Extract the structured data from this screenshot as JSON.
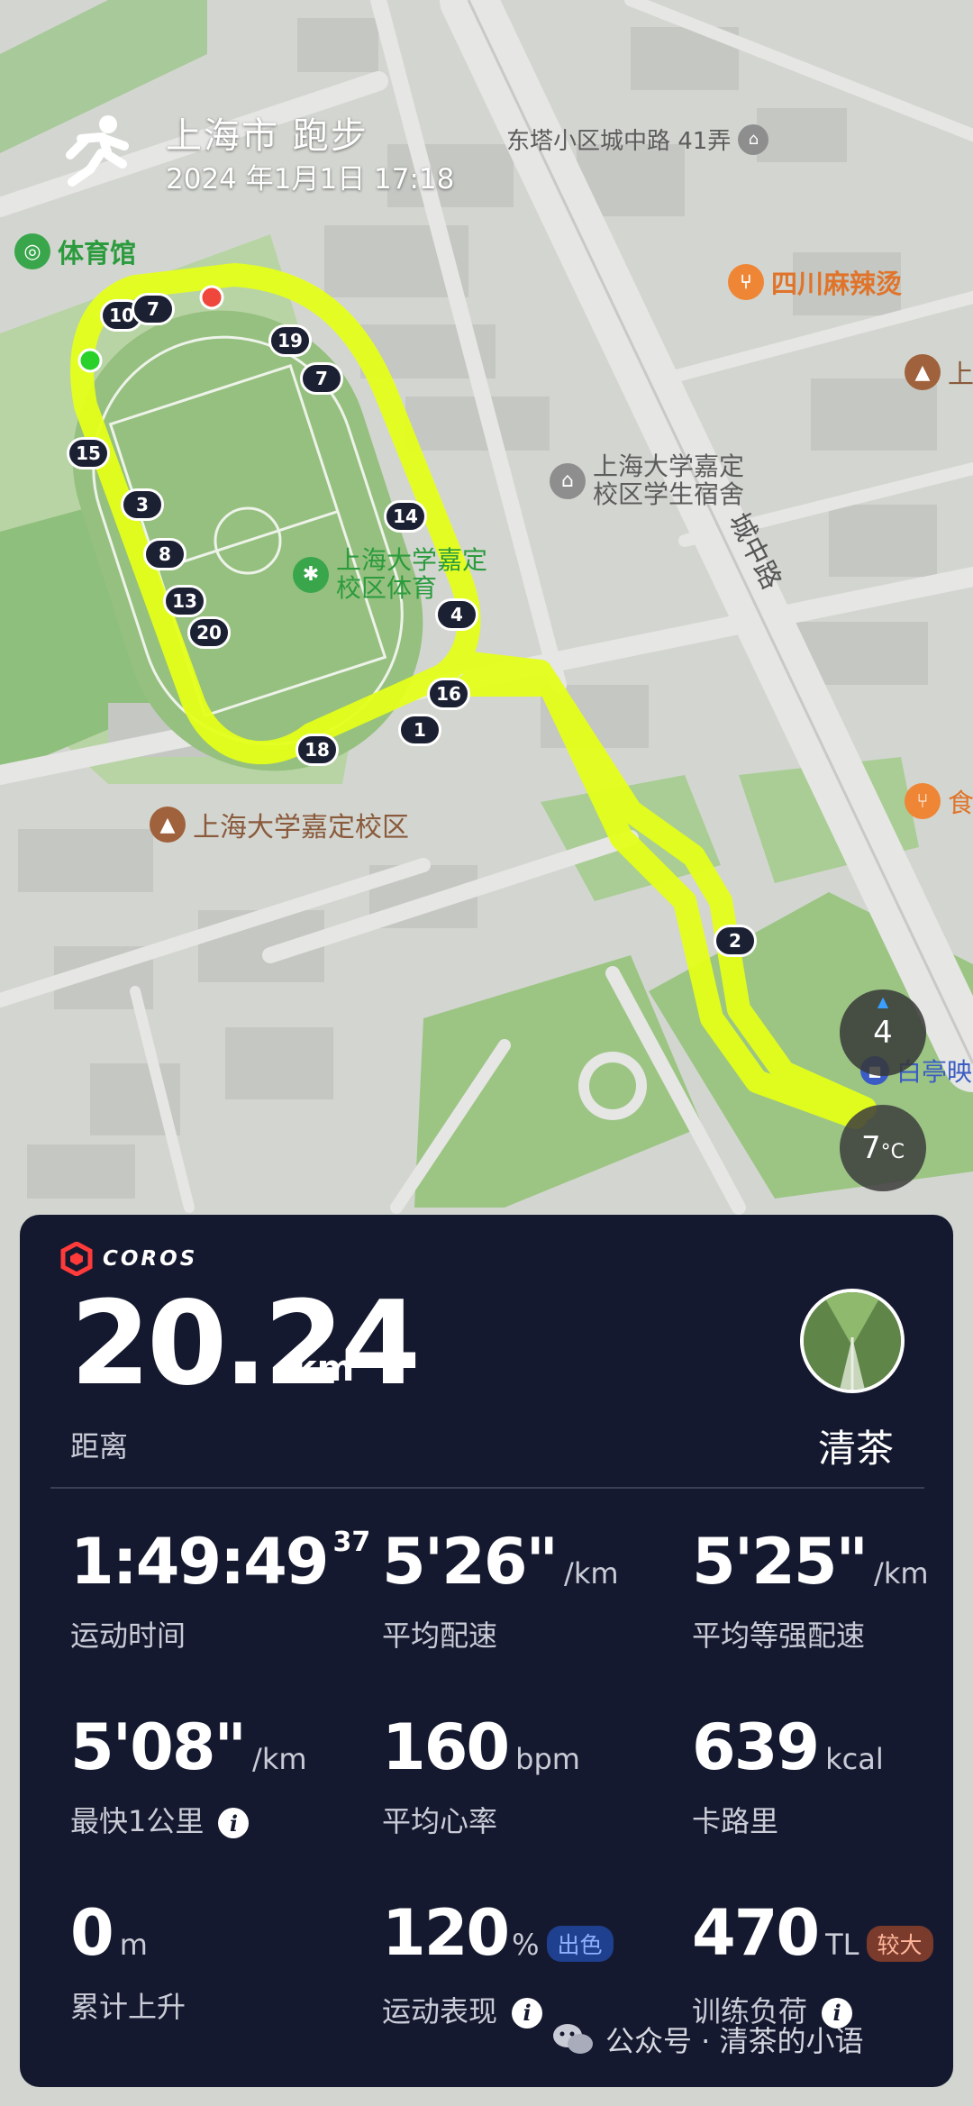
{
  "header": {
    "title": "上海市 跑步",
    "datetime": "2024 年1月1日 17:18"
  },
  "map": {
    "pois": {
      "stadium": "体育馆",
      "dongta_road": "东塔小区城中路 41弄",
      "sichuan": "四川麻辣烫",
      "shu_gym_line1": "上海大学嘉定",
      "shu_gym_line2": "校区体育",
      "dorm_line1": "上海大学嘉定",
      "dorm_line2": "校区学生宿舍",
      "chengzhong_road": "城中路",
      "campus": "上海大学嘉定校区",
      "baiting": "白亭映",
      "edge_shang": "上",
      "edge_shi": "食"
    },
    "km_markers": [
      "10",
      "7",
      "19",
      "7",
      "15",
      "3",
      "8",
      "13",
      "20",
      "14",
      "4",
      "16",
      "1",
      "18",
      "2"
    ],
    "compass_value": "4",
    "temperature": "7",
    "temperature_unit": "°C",
    "route_color": "#e4ff1a"
  },
  "card": {
    "brand": "COROS",
    "distance": "20.24",
    "distance_unit": "km",
    "distance_label": "距离",
    "username": "清茶",
    "stats": {
      "time_main": "1:49:49",
      "time_sup": "37",
      "time_label": "运动时间",
      "avg_pace": "5'26\"",
      "avg_pace_unit": "/km",
      "avg_pace_label": "平均配速",
      "grade_pace": "5'25\"",
      "grade_pace_unit": "/km",
      "grade_pace_label": "平均等强配速",
      "fastest_km": "5'08\"",
      "fastest_km_unit": "/km",
      "fastest_km_label": "最快1公里",
      "hr": "160",
      "hr_unit": "bpm",
      "hr_label": "平均心率",
      "cal": "639",
      "cal_unit": "kcal",
      "cal_label": "卡路里",
      "ascent": "0",
      "ascent_unit": "m",
      "ascent_label": "累计上升",
      "perf": "120",
      "perf_unit": "%",
      "perf_badge": "出色",
      "perf_label": "运动表现",
      "load": "470",
      "load_unit": "TL",
      "load_badge": "较大",
      "load_label": "训练负荷"
    },
    "colors": {
      "background": "#15192f",
      "perf_badge_bg": "#1f3f8f",
      "load_badge_bg": "#7a3b2c"
    }
  },
  "watermark": "公众号 · 清茶的小语"
}
